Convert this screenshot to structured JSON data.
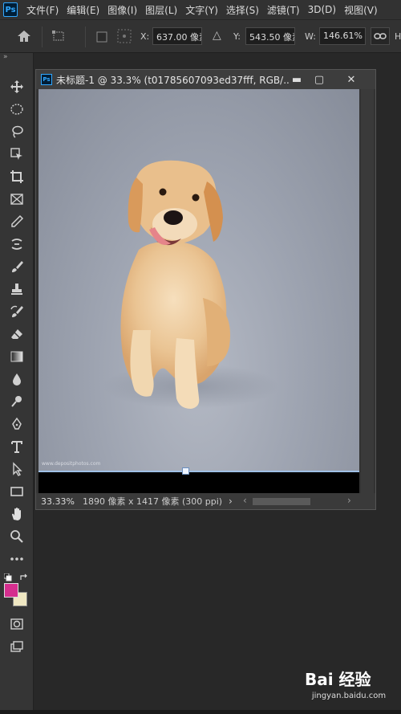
{
  "app": {
    "logo": "Ps",
    "menus": [
      "文件(F)",
      "编辑(E)",
      "图像(I)",
      "图层(L)",
      "文字(Y)",
      "选择(S)",
      "滤镜(T)",
      "3D(D)",
      "视图(V)"
    ]
  },
  "options": {
    "x_label": "X:",
    "x_value": "637.00 像素",
    "y_label": "Y:",
    "y_value": "543.50 像素",
    "w_label": "W:",
    "w_value": "146.61%",
    "h_label": "H"
  },
  "toolbar": {
    "collapse": "»"
  },
  "document": {
    "title": "未标题-1 @ 33.3% (t01785607093ed37fff, RGB/...",
    "minimize": "▬",
    "maximize": "▢",
    "close": "✕",
    "watermark": "www.depositphotos.com"
  },
  "status": {
    "zoom": "33.33%",
    "info": "1890 像素 x 1417 像素 (300 ppi)",
    "arrow": "›",
    "scroll_left": "‹",
    "scroll_right": "›"
  },
  "brand": {
    "name": "Bai  经验",
    "domain": "jingyan.baidu.com"
  },
  "colors": {
    "foreground": "#d52e8e",
    "background": "#efe7c2"
  }
}
